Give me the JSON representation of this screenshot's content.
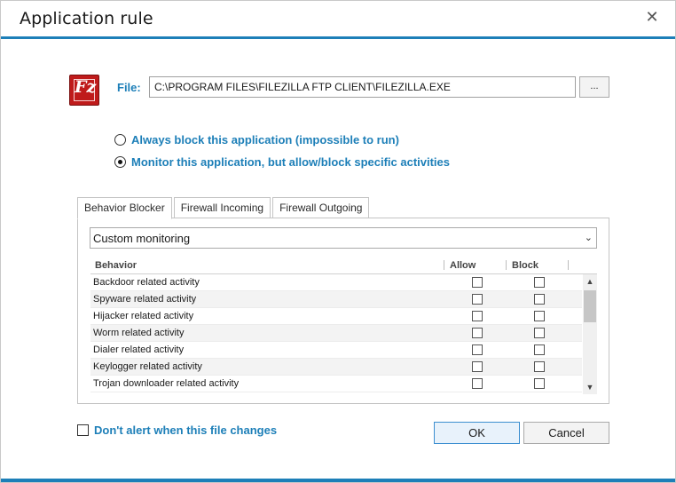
{
  "window": {
    "title": "Application rule",
    "close_icon": "close-icon",
    "accent_color": "#1d7fb8"
  },
  "file": {
    "icon": "filezilla-icon",
    "icon_glyph": "Fz",
    "label": "File:",
    "value": "C:\\PROGRAM FILES\\FILEZILLA FTP CLIENT\\FILEZILLA.EXE",
    "browse_label": "..."
  },
  "mode": {
    "options": [
      {
        "label": "Always block this application (impossible to run)",
        "selected": false
      },
      {
        "label": "Monitor this application, but allow/block specific activities",
        "selected": true
      }
    ]
  },
  "tabs": [
    {
      "label": "Behavior Blocker",
      "active": true
    },
    {
      "label": "Firewall Incoming",
      "active": false
    },
    {
      "label": "Firewall Outgoing",
      "active": false
    }
  ],
  "monitoring": {
    "selected": "Custom monitoring",
    "arrow_icon": "chevron-down-icon"
  },
  "behavior_table": {
    "columns": [
      "Behavior",
      "Allow",
      "Block"
    ],
    "rows": [
      {
        "behavior": "Backdoor related activity",
        "allow": false,
        "block": false
      },
      {
        "behavior": "Spyware related activity",
        "allow": false,
        "block": false
      },
      {
        "behavior": "Hijacker related activity",
        "allow": false,
        "block": false
      },
      {
        "behavior": "Worm related activity",
        "allow": false,
        "block": false
      },
      {
        "behavior": "Dialer related activity",
        "allow": false,
        "block": false
      },
      {
        "behavior": "Keylogger related activity",
        "allow": false,
        "block": false
      },
      {
        "behavior": "Trojan downloader related activity",
        "allow": false,
        "block": false
      }
    ]
  },
  "footer": {
    "dont_alert_label": "Don't alert when this file changes",
    "dont_alert_checked": false,
    "ok_label": "OK",
    "cancel_label": "Cancel"
  }
}
